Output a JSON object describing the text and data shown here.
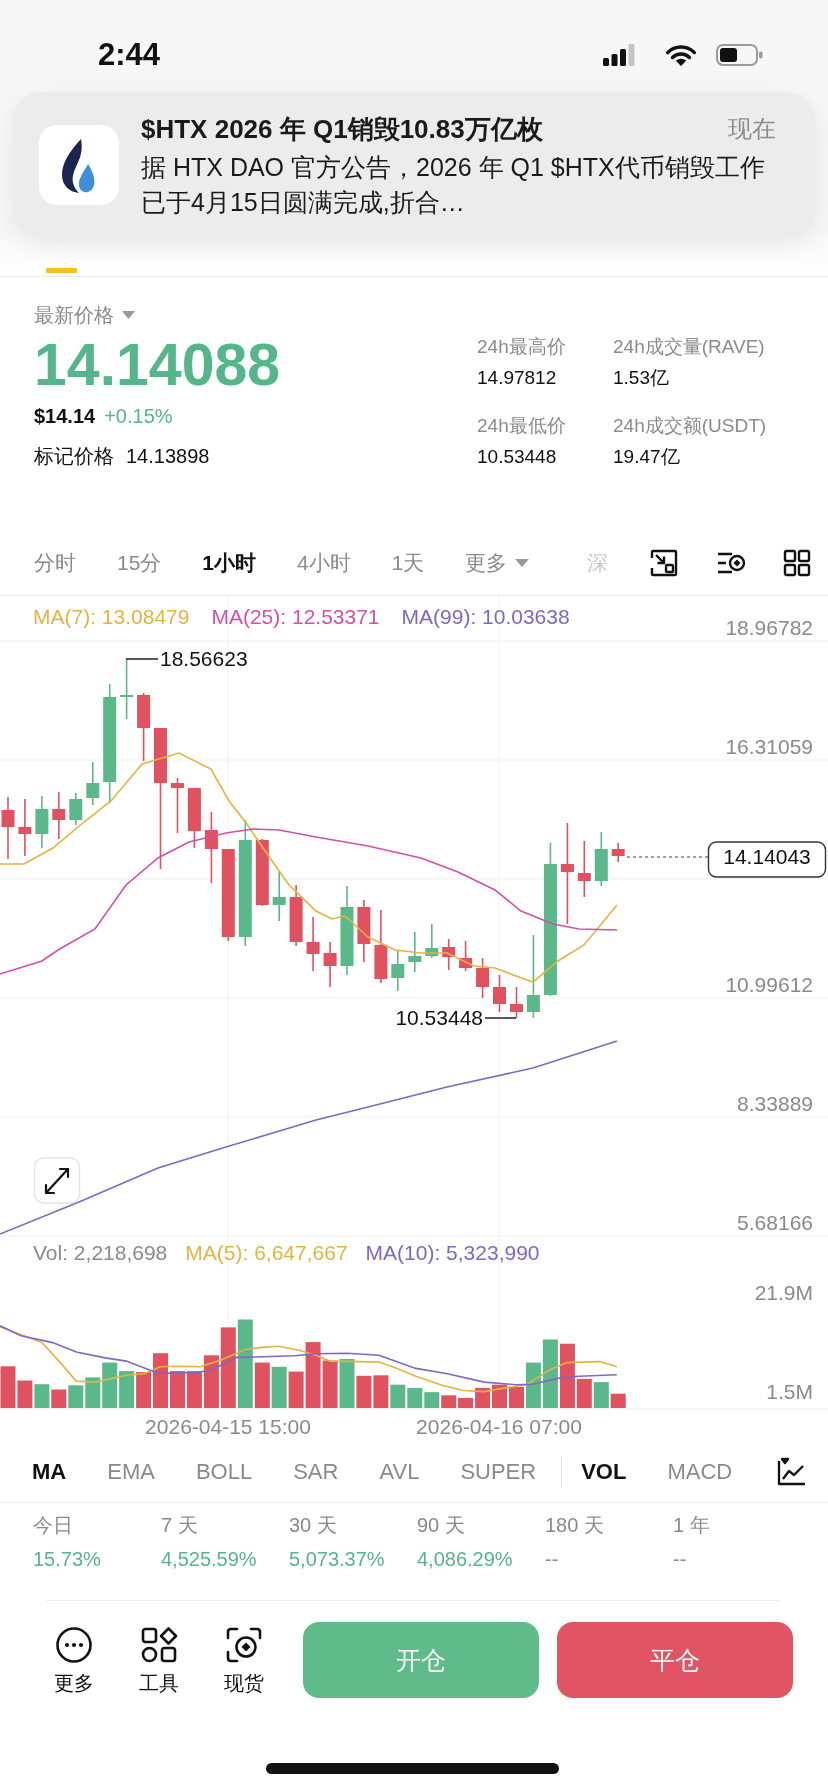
{
  "status_bar": {
    "time": "2:44"
  },
  "notification": {
    "title": "$HTX 2026 年 Q1销毁10.83万亿枚",
    "time": "现在",
    "body": "据 HTX DAO 官方公告，2026 年 Q1 $HTX代币销毁工作已于4月15日圆满完成,折合…"
  },
  "price": {
    "label": "最新价格",
    "last": "14.14088",
    "usd": "$14.14",
    "change": "+0.15%",
    "mark_label": "标记价格",
    "mark_value": "14.13898"
  },
  "stats": [
    {
      "label": "24h最高价",
      "value": "14.97812"
    },
    {
      "label": "24h成交量(RAVE)",
      "value": "1.53亿"
    },
    {
      "label": "24h最低价",
      "value": "10.53448"
    },
    {
      "label": "24h成交额(USDT)",
      "value": "19.47亿"
    }
  ],
  "intervals": [
    {
      "label": "分时",
      "selected": false,
      "kind": "tab"
    },
    {
      "label": "15分",
      "selected": false,
      "kind": "tab"
    },
    {
      "label": "1小时",
      "selected": true,
      "kind": "tab"
    },
    {
      "label": "4小时",
      "selected": false,
      "kind": "tab"
    },
    {
      "label": "1天",
      "selected": false,
      "kind": "tab"
    },
    {
      "label": "更多",
      "selected": false,
      "kind": "menu"
    },
    {
      "label": "深",
      "selected": false,
      "kind": "faded"
    }
  ],
  "chart": {
    "legend": [
      {
        "label": "MA(7): 13.08479",
        "color": "#e2b440"
      },
      {
        "label": "MA(25): 12.53371",
        "color": "#d250a9"
      },
      {
        "label": "MA(99): 10.03638",
        "color": "#7e68c4"
      }
    ],
    "y_labels": [
      "18.96782",
      "16.31059",
      "10.99612",
      "8.33889",
      "5.68166"
    ],
    "high_label": "18.56623",
    "low_label": "10.53448",
    "current_price": "14.14043"
  },
  "volume": {
    "label": "Vol: 2,218,698",
    "legend": [
      {
        "label": "MA(5): 6,647,667",
        "color": "#e2b440"
      },
      {
        "label": "MA(10): 5,323,990",
        "color": "#7e68c4"
      }
    ],
    "y_labels": [
      "21.9M",
      "1.5M"
    ]
  },
  "x_labels": [
    "2026-04-15 15:00",
    "2026-04-16 07:00"
  ],
  "main_indicators": [
    {
      "label": "MA",
      "selected": true
    },
    {
      "label": "EMA",
      "selected": false
    },
    {
      "label": "BOLL",
      "selected": false
    },
    {
      "label": "SAR",
      "selected": false
    },
    {
      "label": "AVL",
      "selected": false
    },
    {
      "label": "SUPER",
      "selected": false
    }
  ],
  "sub_indicators": [
    {
      "label": "VOL",
      "selected": true
    },
    {
      "label": "MACD",
      "selected": false
    }
  ],
  "returns": [
    {
      "period": "今日",
      "value": "15.73%",
      "kind": "gain"
    },
    {
      "period": "7 天",
      "value": "4,525.59%",
      "kind": "gain"
    },
    {
      "period": "30 天",
      "value": "5,073.37%",
      "kind": "gain"
    },
    {
      "period": "90 天",
      "value": "4,086.29%",
      "kind": "gain"
    },
    {
      "period": "180 天",
      "value": "--",
      "kind": "empty"
    },
    {
      "period": "1 年",
      "value": "--",
      "kind": "empty"
    }
  ],
  "nav": [
    {
      "label": "更多"
    },
    {
      "label": "工具"
    },
    {
      "label": "现货"
    }
  ],
  "actions": [
    {
      "label": "开仓",
      "kind": "open"
    },
    {
      "label": "平仓",
      "kind": "close"
    }
  ]
}
